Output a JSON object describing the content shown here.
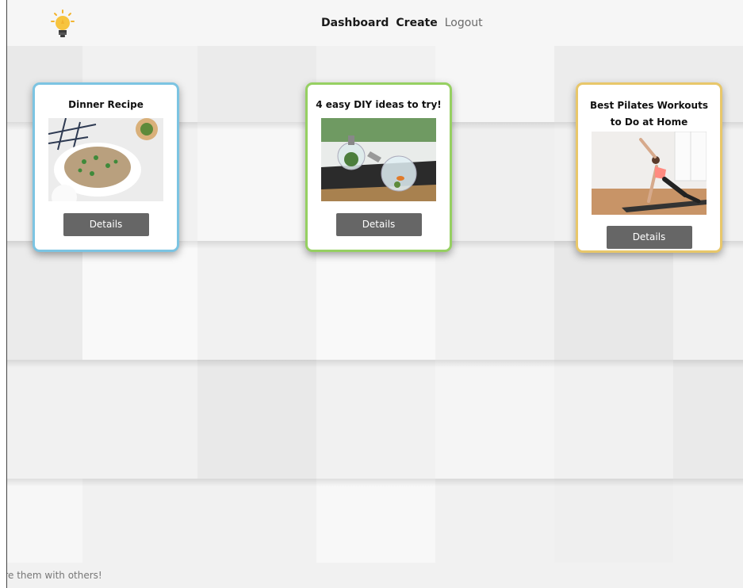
{
  "nav": {
    "links": [
      {
        "label": "Dashboard",
        "style": "bold"
      },
      {
        "label": "Create",
        "style": "bold"
      },
      {
        "label": "Logout",
        "style": "muted"
      }
    ]
  },
  "cards": [
    {
      "title": "Dinner Recipe",
      "image_alt": "Dinner Recipe",
      "button_label": "Details",
      "border_color": "#7cc4e2"
    },
    {
      "title": "4 easy DIY ideas to try!",
      "image_alt": "4 easy DIY ideas to try!",
      "button_label": "Details",
      "border_color": "#96d062"
    },
    {
      "title": "Best Pilates Workouts to Do at Home",
      "image_alt": "Best Pilates Workouts to Do at Home",
      "button_label": "Details",
      "border_color": "#e8c76a"
    }
  ],
  "footer": {
    "text": "are them with others!"
  },
  "colors": {
    "button": "#666666",
    "navbar": "#f6f6f6",
    "background": "#f1f1f1"
  }
}
